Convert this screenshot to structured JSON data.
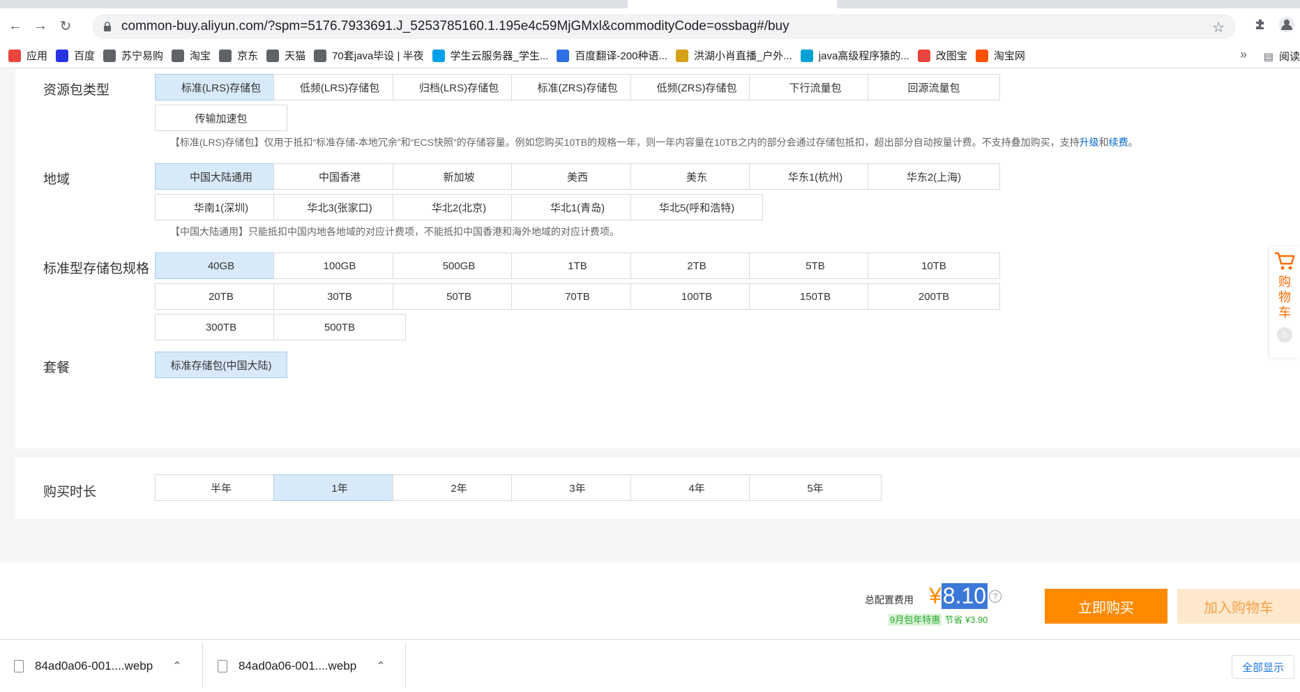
{
  "browser": {
    "url": "common-buy.aliyun.com/?spm=5176.7933691.J_5253785160.1.195e4c59MjGMxl&commodityCode=ossbag#/buy",
    "bookmarks": [
      {
        "label": "应用",
        "icon": "apps-grid-icon",
        "color": "#e8453c"
      },
      {
        "label": "百度",
        "icon": "baidu-paw-icon",
        "color": "#2932e1"
      },
      {
        "label": "苏宁易购",
        "icon": "globe-icon",
        "color": "#5f6368"
      },
      {
        "label": "淘宝",
        "icon": "globe-icon",
        "color": "#5f6368"
      },
      {
        "label": "京东",
        "icon": "globe-icon",
        "color": "#5f6368"
      },
      {
        "label": "天猫",
        "icon": "globe-icon",
        "color": "#5f6368"
      },
      {
        "label": "70套java毕设 | 半夜",
        "icon": "globe-icon",
        "color": "#5f6368"
      },
      {
        "label": "学生云服务器_学生...",
        "icon": "cloud-icon",
        "color": "#00a0e9"
      },
      {
        "label": "百度翻译-200种语...",
        "icon": "translate-icon",
        "color": "#2f6fe5"
      },
      {
        "label": "洪湖小肖直播_户外...",
        "icon": "bird-icon",
        "color": "#d4a017"
      },
      {
        "label": "java高级程序猿的...",
        "icon": "bilibili-icon",
        "color": "#00a1d6"
      },
      {
        "label": "改图宝",
        "icon": "square-icon",
        "color": "#e8453c"
      },
      {
        "label": "淘宝网",
        "icon": "taobao-icon",
        "color": "#ff5000"
      }
    ],
    "more": "»",
    "reading_list": "阅读"
  },
  "sections": {
    "resource_type": {
      "label": "资源包类型",
      "options": [
        "标准(LRS)存储包",
        "低频(LRS)存储包",
        "归档(LRS)存储包",
        "标准(ZRS)存储包",
        "低频(ZRS)存储包",
        "下行流量包",
        "回源流量包",
        "传输加速包"
      ],
      "selected": 0,
      "note_prefix": "【标准(LRS)存储包】仅用于抵扣“标准存储-本地冗余”和“ECS快照”的存储容量。例如您购买10TB的规格一年，则一年内容量在10TB之内的部分会通过存储包抵扣，超出部分自动按量计费。不支持叠加购买，支持",
      "note_link1": "升级",
      "note_and": "和",
      "note_link2": "续费",
      "note_suffix": "。"
    },
    "region": {
      "label": "地域",
      "options": [
        "中国大陆通用",
        "中国香港",
        "新加坡",
        "美西",
        "美东",
        "华东1(杭州)",
        "华东2(上海)",
        "华南1(深圳)",
        "华北3(张家口)",
        "华北2(北京)",
        "华北1(青岛)",
        "华北5(呼和浩特)"
      ],
      "selected": 0,
      "note": "【中国大陆通用】只能抵扣中国内地各地域的对应计费项，不能抵扣中国香港和海外地域的对应计费项。"
    },
    "spec": {
      "label": "标准型存储包规格",
      "options": [
        "40GB",
        "100GB",
        "500GB",
        "1TB",
        "2TB",
        "5TB",
        "10TB",
        "20TB",
        "30TB",
        "50TB",
        "70TB",
        "100TB",
        "150TB",
        "200TB",
        "300TB",
        "500TB"
      ],
      "selected": 0
    },
    "package": {
      "label": "套餐",
      "options": [
        "标准存储包(中国大陆)"
      ],
      "selected": 0
    },
    "duration": {
      "label": "购买时长",
      "options": [
        "半年",
        "1年",
        "2年",
        "3年",
        "4年",
        "5年"
      ],
      "selected": 1
    }
  },
  "cart_widget": {
    "label": "购物车",
    "count": "0",
    "icon": "shopping-cart-icon"
  },
  "footer": {
    "fee_label": "总配置费用",
    "currency": "¥",
    "price": "8.10",
    "promo_tag": "9月包年特惠",
    "promo_save": "节省 ¥3.90",
    "buy_now": "立即购买",
    "add_to_cart": "加入购物车"
  },
  "downloads": {
    "items": [
      "84ad0a06-001....webp",
      "84ad0a06-001....webp"
    ],
    "show_all": "全部显示"
  },
  "colors": {
    "accent": "#ff8a00",
    "selected_bg": "#d8e9f9",
    "link": "#0066cc",
    "promo_green": "#2aa82a"
  }
}
